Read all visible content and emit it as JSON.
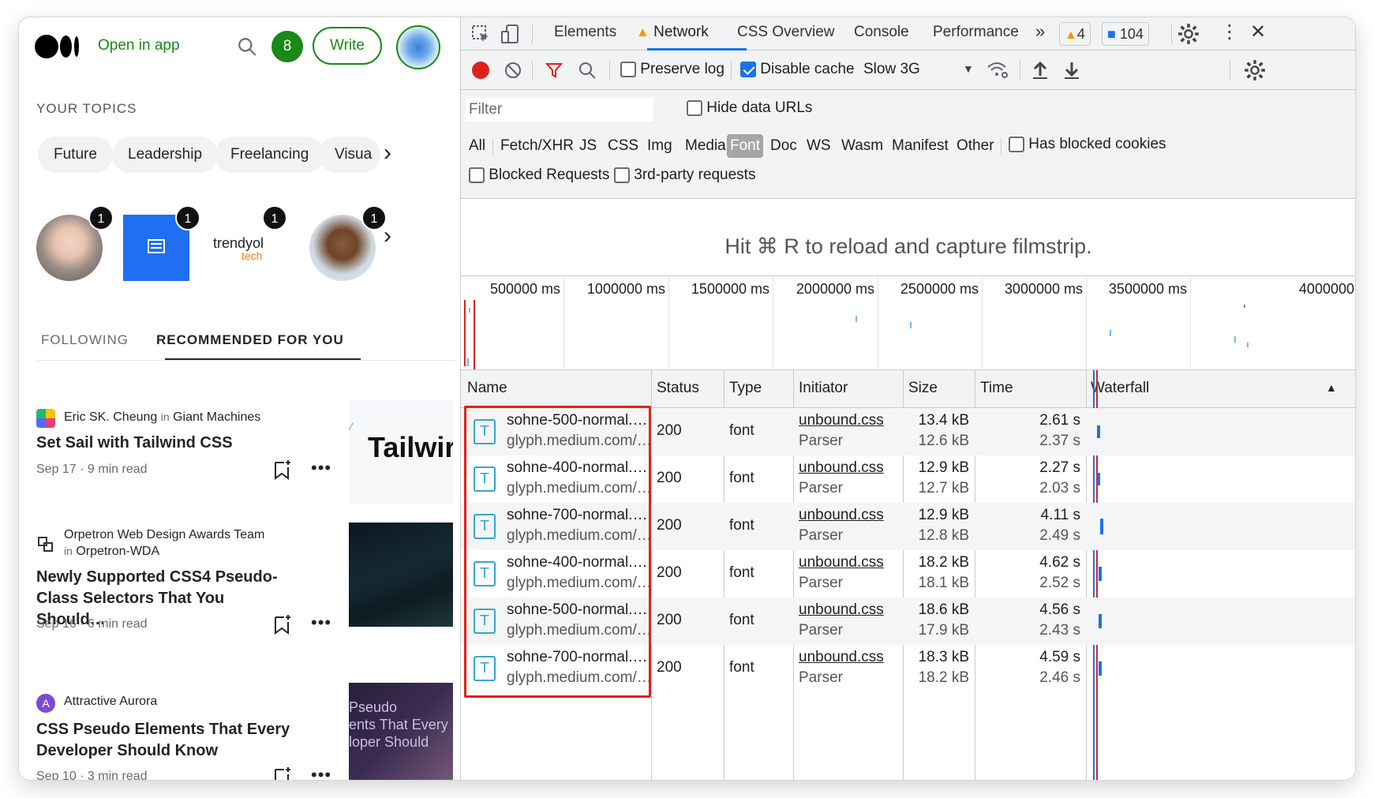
{
  "medium": {
    "open_in_app": "Open in app",
    "notification_count": "8",
    "write_label": "Write",
    "your_topics": "YOUR TOPICS",
    "topics": [
      "Future",
      "Leadership",
      "Freelancing",
      "Visua"
    ],
    "story_badges": [
      "1",
      "1",
      "1",
      "1"
    ],
    "trendyol_name": "trendyol",
    "trendyol_sub": "tech",
    "tabs": {
      "following": "FOLLOWING",
      "recommended": "RECOMMENDED FOR YOU"
    },
    "posts": [
      {
        "author": "Eric SK. Cheung",
        "in_word": "in",
        "publication": "Giant Machines",
        "title": "Set Sail with Tailwind CSS",
        "meta": "Sep 17 · 9 min read",
        "thumb_text": "Tailwir"
      },
      {
        "author": "Orpetron Web Design Awards Team",
        "in_word": "in",
        "publication": "Orpetron-WDA",
        "title": "Newly Supported CSS4 Pseudo-Class Selectors That You Should…",
        "meta": "Sep 16 · 6 min read"
      },
      {
        "author": "Attractive Aurora",
        "author_initial": "A",
        "title": "CSS Pseudo Elements That Every Developer Should Know",
        "meta": "Sep 10 · 3 min read",
        "thumb_lines": [
          "Pseudo",
          "ents That Every",
          "loper Should"
        ]
      }
    ]
  },
  "devtools": {
    "tabs": [
      "Elements",
      "Network",
      "CSS Overview",
      "Console",
      "Performance"
    ],
    "more_tabs": "»",
    "warnings_count": "4",
    "messages_count": "104",
    "toolbar": {
      "preserve_log": "Preserve log",
      "disable_cache": "Disable cache",
      "throttling": "Slow 3G"
    },
    "filter_placeholder": "Filter",
    "hide_data_urls": "Hide data URLs",
    "type_filters": [
      "All",
      "Fetch/XHR",
      "JS",
      "CSS",
      "Img",
      "Media",
      "Font",
      "Doc",
      "WS",
      "Wasm",
      "Manifest",
      "Other"
    ],
    "selected_type": "Font",
    "has_blocked_cookies": "Has blocked cookies",
    "blocked_requests": "Blocked Requests",
    "third_party": "3rd-party requests",
    "filmstrip_message": "Hit ⌘ R to reload and capture filmstrip.",
    "timeline_labels": [
      "500000 ms",
      "1000000 ms",
      "1500000 ms",
      "2000000 ms",
      "2500000 ms",
      "3000000 ms",
      "3500000 ms",
      "4000000"
    ],
    "columns": [
      "Name",
      "Status",
      "Type",
      "Initiator",
      "Size",
      "Time",
      "Waterfall"
    ],
    "rows": [
      {
        "name": "sohne-500-normal.…",
        "domain": "glyph.medium.com/…",
        "status": "200",
        "type": "font",
        "initiator": "unbound.css",
        "initiator_type": "Parser",
        "size": "13.4 kB",
        "resource_size": "12.6 kB",
        "time": "2.61 s",
        "latency": "2.37 s"
      },
      {
        "name": "sohne-400-normal.…",
        "domain": "glyph.medium.com/…",
        "status": "200",
        "type": "font",
        "initiator": "unbound.css",
        "initiator_type": "Parser",
        "size": "12.9 kB",
        "resource_size": "12.7 kB",
        "time": "2.27 s",
        "latency": "2.03 s"
      },
      {
        "name": "sohne-700-normal.…",
        "domain": "glyph.medium.com/…",
        "status": "200",
        "type": "font",
        "initiator": "unbound.css",
        "initiator_type": "Parser",
        "size": "12.9 kB",
        "resource_size": "12.8 kB",
        "time": "4.11 s",
        "latency": "2.49 s"
      },
      {
        "name": "sohne-400-normal.…",
        "domain": "glyph.medium.com/…",
        "status": "200",
        "type": "font",
        "initiator": "unbound.css",
        "initiator_type": "Parser",
        "size": "18.2 kB",
        "resource_size": "18.1 kB",
        "time": "4.62 s",
        "latency": "2.52 s"
      },
      {
        "name": "sohne-500-normal.…",
        "domain": "glyph.medium.com/…",
        "status": "200",
        "type": "font",
        "initiator": "unbound.css",
        "initiator_type": "Parser",
        "size": "18.6 kB",
        "resource_size": "17.9 kB",
        "time": "4.56 s",
        "latency": "2.43 s"
      },
      {
        "name": "sohne-700-normal.…",
        "domain": "glyph.medium.com/…",
        "status": "200",
        "type": "font",
        "initiator": "unbound.css",
        "initiator_type": "Parser",
        "size": "18.3 kB",
        "resource_size": "18.2 kB",
        "time": "4.59 s",
        "latency": "2.46 s"
      }
    ],
    "font_icon_letter": "T"
  },
  "colors": {
    "medium_green": "#1a8917",
    "devtools_blue": "#1a73e8",
    "highlight_red": "#e0201c",
    "record_red": "#e0201c"
  }
}
